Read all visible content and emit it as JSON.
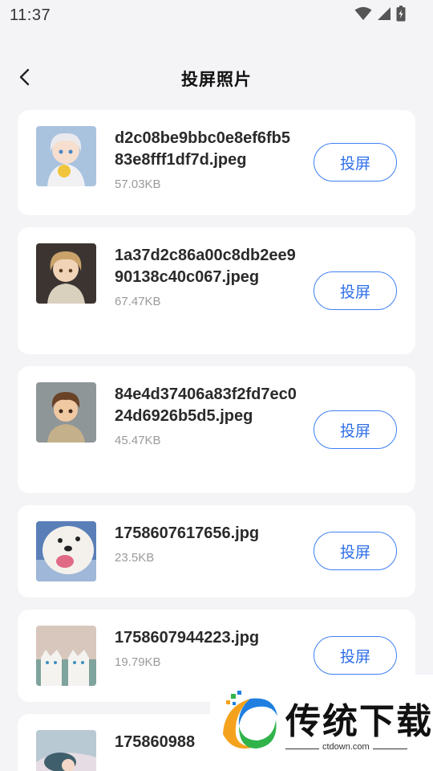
{
  "status_bar": {
    "time": "11:37"
  },
  "header": {
    "title": "投屏照片"
  },
  "items": [
    {
      "name": "d2c08be9bbc0e8ef6fb583e8fff1df7d.jpeg",
      "size": "57.03KB",
      "action": "投屏",
      "thumb": "anime-white-hair-boy"
    },
    {
      "name": "1a37d2c86a00c8db2ee990138c40c067.jpeg",
      "size": "67.47KB",
      "action": "投屏",
      "thumb": "anime-blonde-boy"
    },
    {
      "name": "84e4d37406a83f2fd7ec024d6926b5d5.jpeg",
      "size": "45.47KB",
      "action": "投屏",
      "thumb": "cartoon-brown-hair-boy"
    },
    {
      "name": "1758607617656.jpg",
      "size": "23.5KB",
      "action": "投屏",
      "thumb": "white-dog"
    },
    {
      "name": "1758607944223.jpg",
      "size": "19.79KB",
      "action": "投屏",
      "thumb": "two-white-cats"
    },
    {
      "name": "175860988",
      "size": "",
      "action": "",
      "thumb": "anime-girl-lying"
    }
  ],
  "watermark": {
    "text": "传统下载",
    "url": "ctdown.com"
  }
}
